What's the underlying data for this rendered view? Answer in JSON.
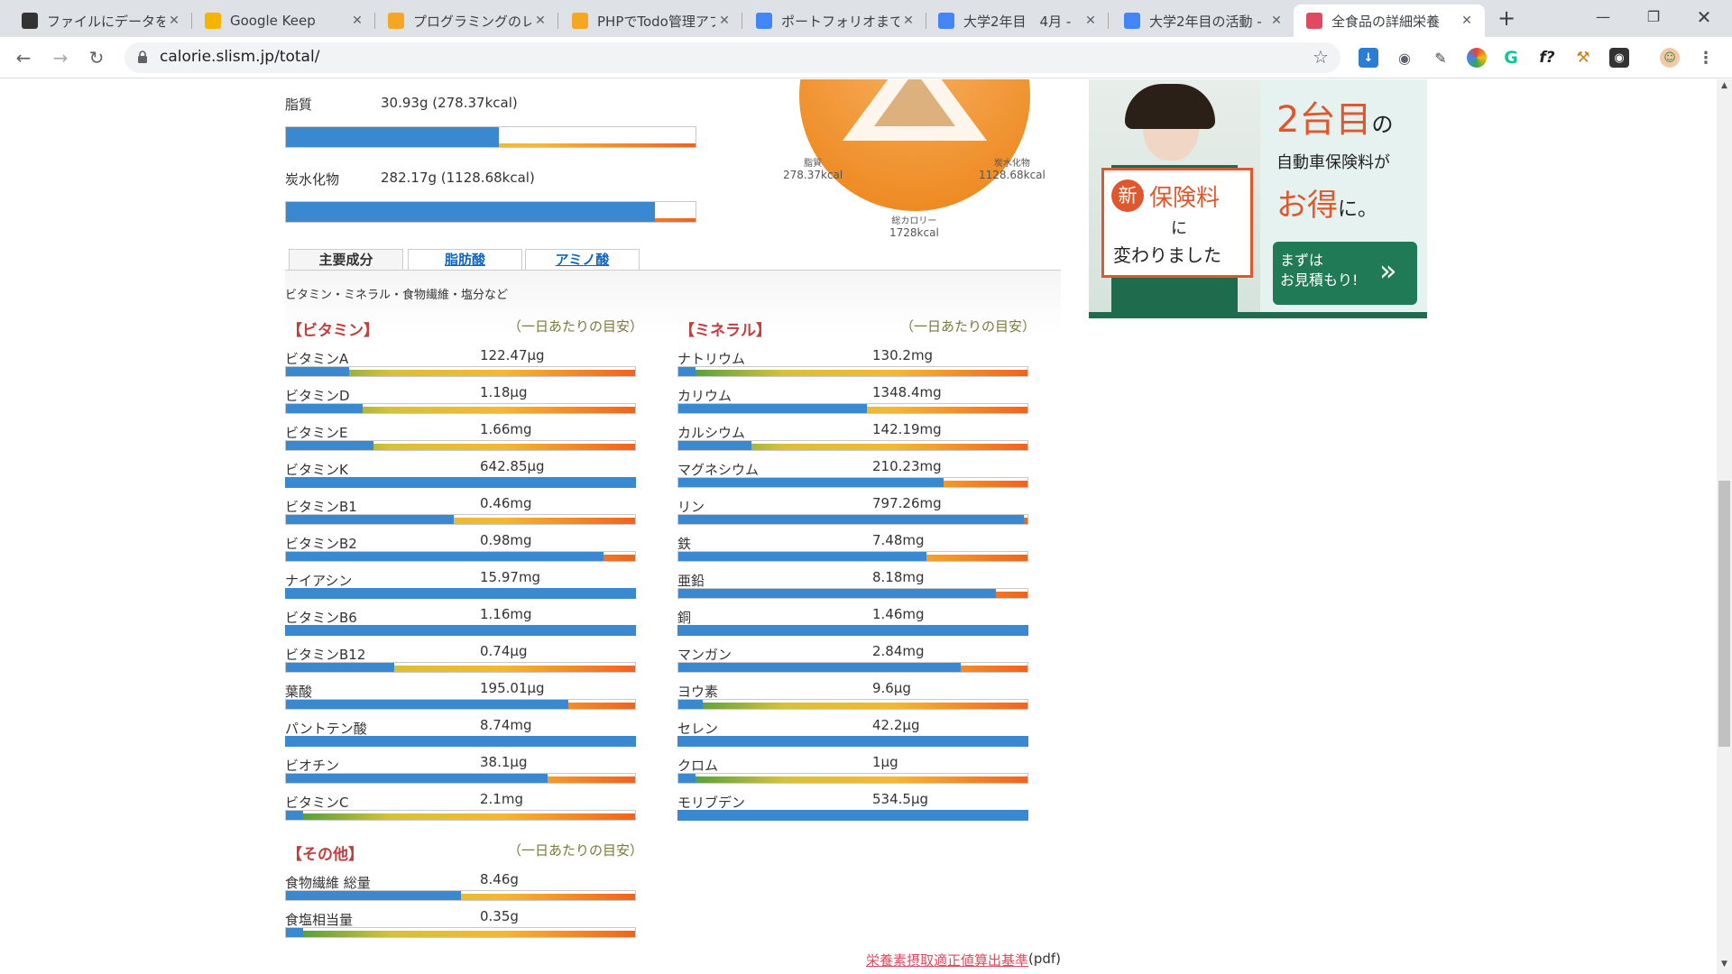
{
  "browser": {
    "tabs": [
      {
        "title": "ファイルにデータを保存",
        "icon": "g-square-icon",
        "color": "#333333"
      },
      {
        "title": "Google Keep",
        "icon": "keep-icon",
        "color": "#f4b400"
      },
      {
        "title": "プログラミングのレッス",
        "icon": "box-icon",
        "color": "#f5a623"
      },
      {
        "title": "PHPでTodo管理アプ",
        "icon": "box-icon",
        "color": "#f5a623"
      },
      {
        "title": "ポートフォリオまでの道",
        "icon": "docs-icon",
        "color": "#4285f4"
      },
      {
        "title": "大学2年目　4月 -",
        "icon": "docs-icon",
        "color": "#4285f4"
      },
      {
        "title": "大学2年目の活動 -",
        "icon": "docs-icon",
        "color": "#4285f4"
      },
      {
        "title": "全食品の詳細栄養",
        "icon": "slism-icon",
        "color": "#e0495f"
      }
    ],
    "url": "calorie.slism.jp/total/"
  },
  "macros": [
    {
      "label": "脂質",
      "value": "30.93g (278.37kcal)",
      "pct": 0.52
    },
    {
      "label": "炭水化物",
      "value": "282.17g (1128.68kcal)",
      "pct": 0.9
    }
  ],
  "pie": {
    "fat_label": "脂質",
    "fat_kcal": "278.37kcal",
    "carb_label": "炭水化物",
    "carb_kcal": "1128.68kcal",
    "total_label": "総カロリー",
    "total_kcal": "1728kcal"
  },
  "tabs": [
    "主要成分",
    "脂肪酸",
    "アミノ酸"
  ],
  "subtitle": "ビタミン・ミネラル・食物繊維・塩分など",
  "daily_label": "（一日あたりの目安）",
  "vitamins": {
    "heading": "【ビタミン】",
    "items": [
      {
        "name": "ビタミンA",
        "value": "122.47μg",
        "pct": 0.18
      },
      {
        "name": "ビタミンD",
        "value": "1.18μg",
        "pct": 0.22
      },
      {
        "name": "ビタミンE",
        "value": "1.66mg",
        "pct": 0.25
      },
      {
        "name": "ビタミンK",
        "value": "642.85μg",
        "pct": 1.0
      },
      {
        "name": "ビタミンB1",
        "value": "0.46mg",
        "pct": 0.48
      },
      {
        "name": "ビタミンB2",
        "value": "0.98mg",
        "pct": 0.91
      },
      {
        "name": "ナイアシン",
        "value": "15.97mg",
        "pct": 1.0
      },
      {
        "name": "ビタミンB6",
        "value": "1.16mg",
        "pct": 1.0
      },
      {
        "name": "ビタミンB12",
        "value": "0.74μg",
        "pct": 0.31
      },
      {
        "name": "葉酸",
        "value": "195.01μg",
        "pct": 0.81
      },
      {
        "name": "パントテン酸",
        "value": "8.74mg",
        "pct": 1.0
      },
      {
        "name": "ビオチン",
        "value": "38.1μg",
        "pct": 0.75
      },
      {
        "name": "ビタミンC",
        "value": "2.1mg",
        "pct": 0.05
      }
    ]
  },
  "minerals": {
    "heading": "【ミネラル】",
    "items": [
      {
        "name": "ナトリウム",
        "value": "130.2mg",
        "pct": 0.05
      },
      {
        "name": "カリウム",
        "value": "1348.4mg",
        "pct": 0.54
      },
      {
        "name": "カルシウム",
        "value": "142.19mg",
        "pct": 0.21
      },
      {
        "name": "マグネシウム",
        "value": "210.23mg",
        "pct": 0.76
      },
      {
        "name": "リン",
        "value": "797.26mg",
        "pct": 0.99
      },
      {
        "name": "鉄",
        "value": "7.48mg",
        "pct": 0.71
      },
      {
        "name": "亜鉛",
        "value": "8.18mg",
        "pct": 0.91
      },
      {
        "name": "銅",
        "value": "1.46mg",
        "pct": 1.0
      },
      {
        "name": "マンガン",
        "value": "2.84mg",
        "pct": 0.81
      },
      {
        "name": "ヨウ素",
        "value": "9.6μg",
        "pct": 0.07
      },
      {
        "name": "セレン",
        "value": "42.2μg",
        "pct": 1.0
      },
      {
        "name": "クロム",
        "value": "1μg",
        "pct": 0.05
      },
      {
        "name": "モリブデン",
        "value": "534.5μg",
        "pct": 1.0
      }
    ]
  },
  "others": {
    "heading": "【その他】",
    "items": [
      {
        "name": "食物繊維 総量",
        "value": "8.46g",
        "pct": 0.5
      },
      {
        "name": "食塩相当量",
        "value": "0.35g",
        "pct": 0.05
      }
    ]
  },
  "ad": {
    "line1": "2台目",
    "line1b": "の",
    "line2": "自動車保険料が",
    "line3": "お得",
    "line3b": "に。",
    "badge_new": "新",
    "badge_text": "保険料",
    "badge_ni": "に",
    "badge_changed": "変わりました",
    "cta": "まずは\nお見積もり!"
  },
  "footer": {
    "link": "栄養素摂取適正値算出基準",
    "suffix": "(pdf)"
  }
}
